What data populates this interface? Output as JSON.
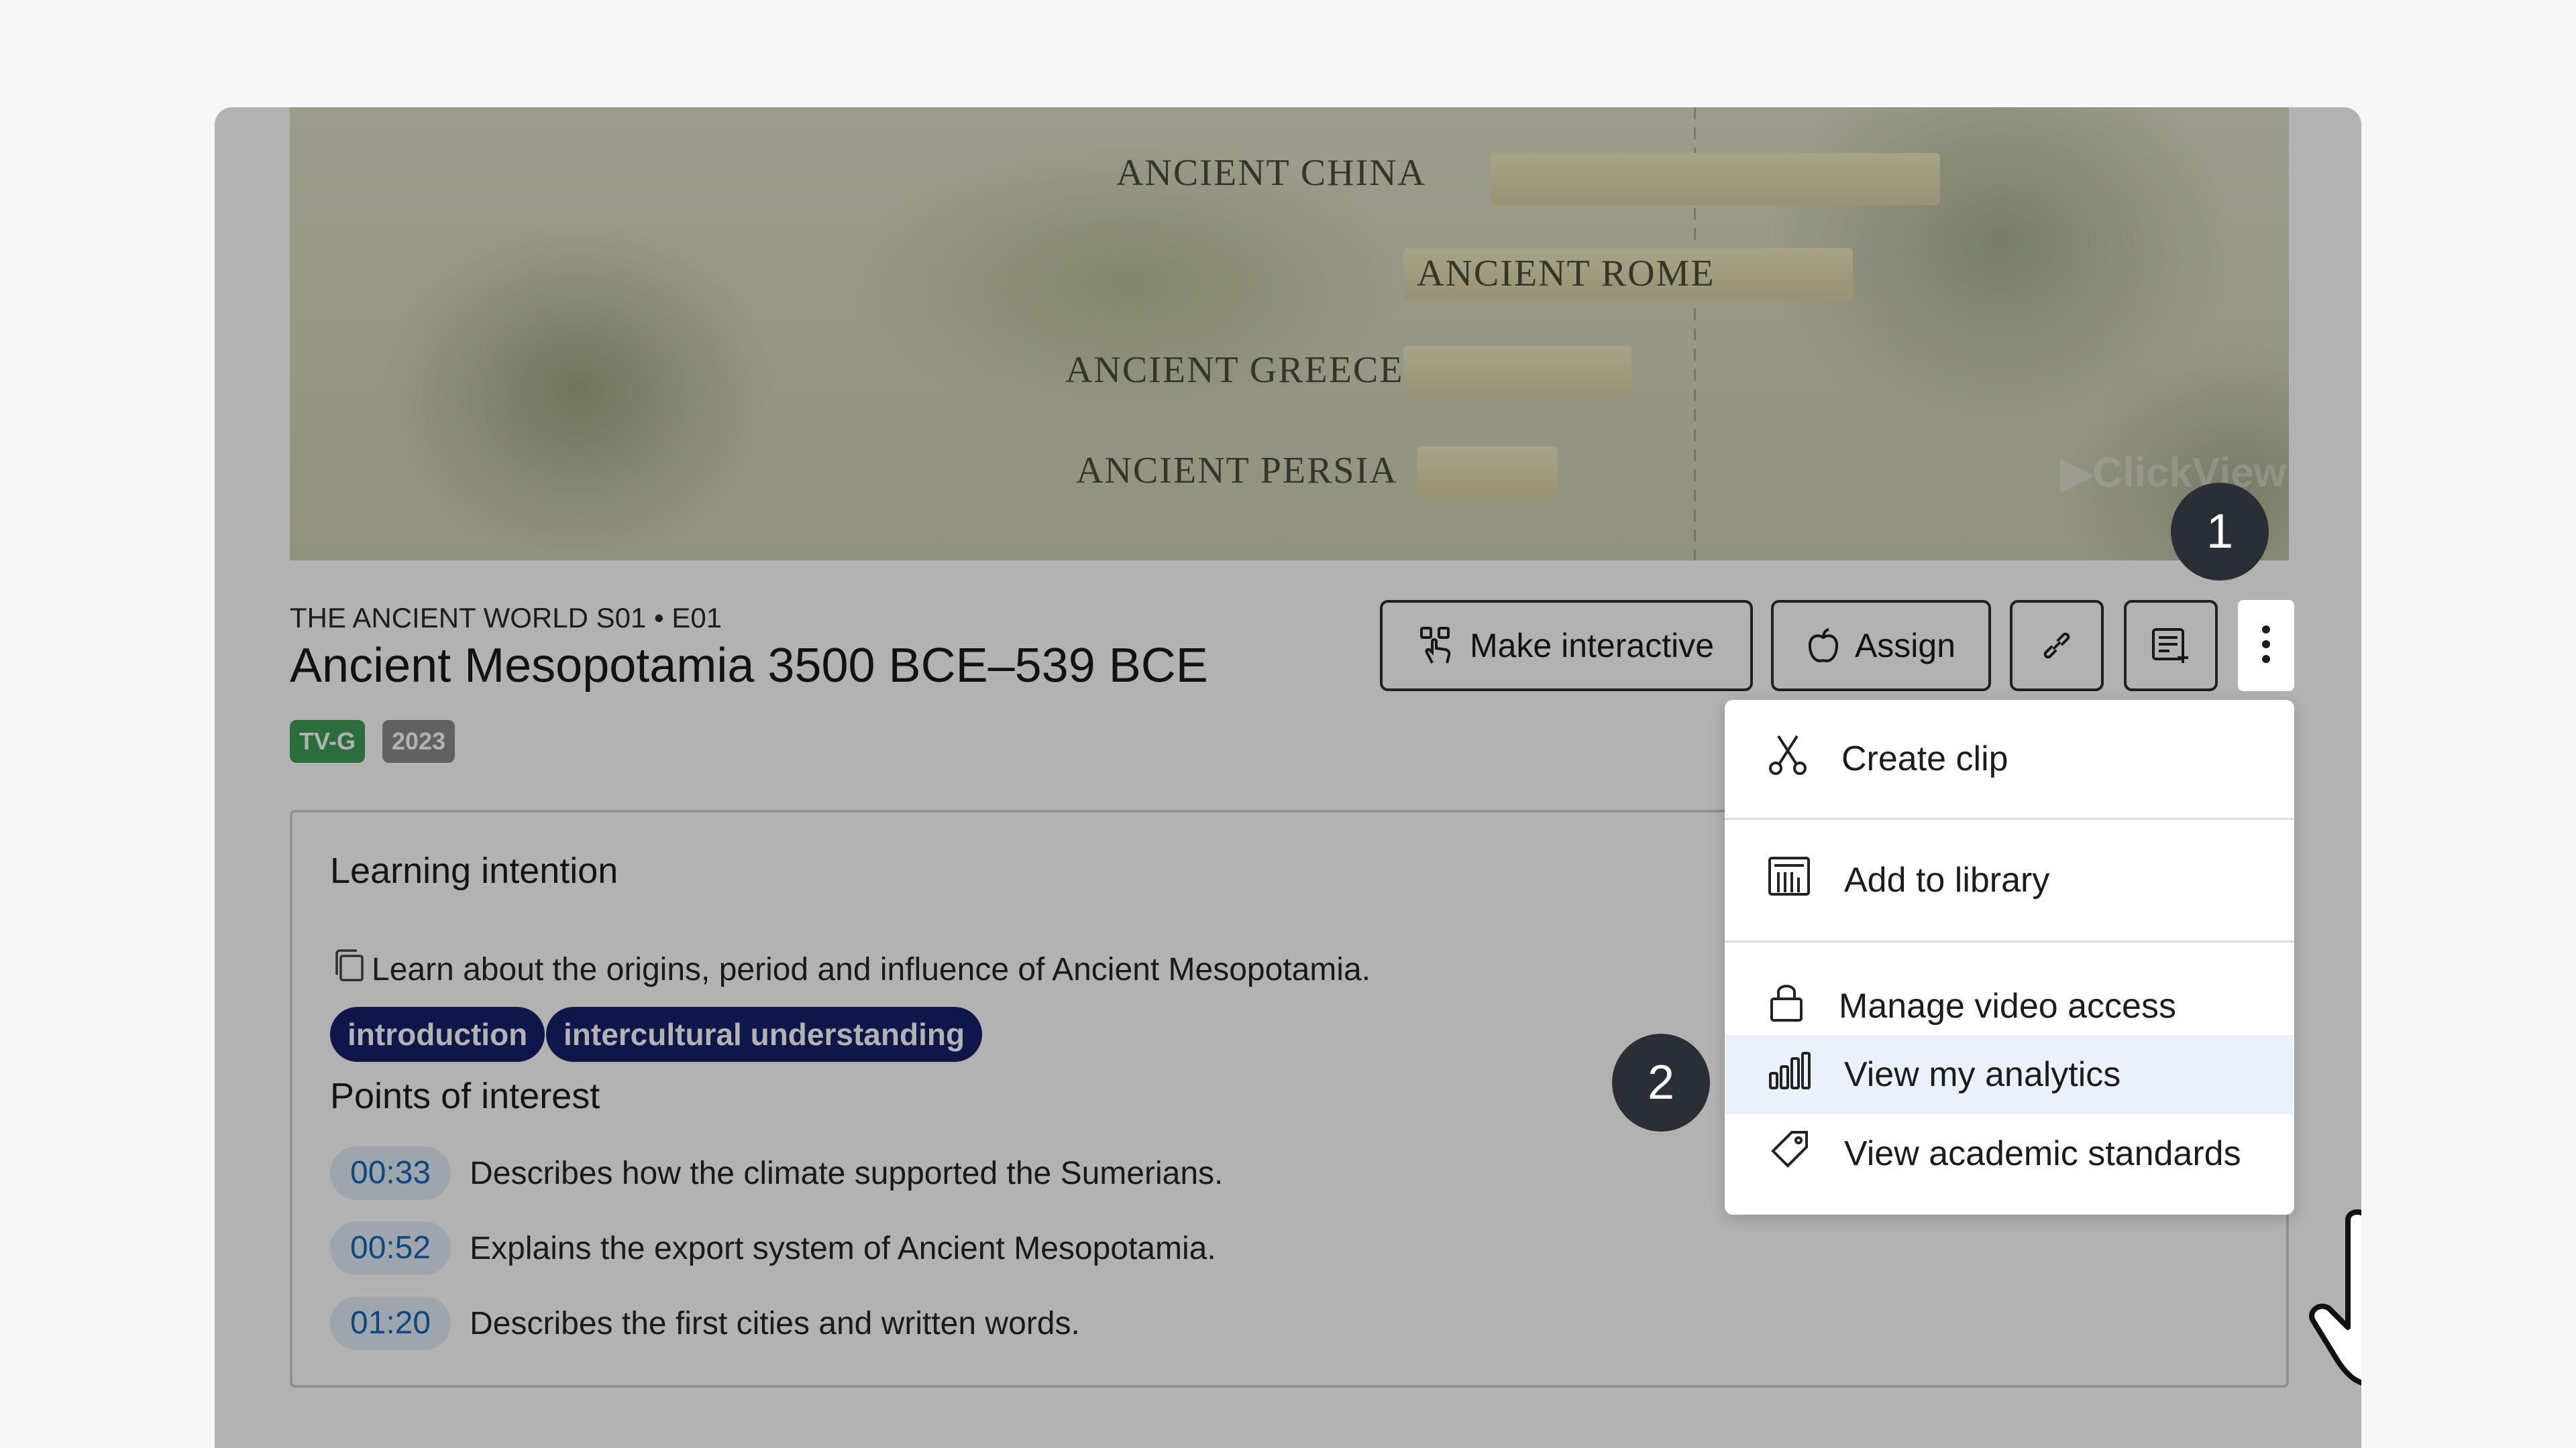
{
  "hero": {
    "labels": [
      "ANCIENT CHINA",
      "ANCIENT ROME",
      "ANCIENT GREECE",
      "ANCIENT PERSIA"
    ],
    "watermark": "▶ClickView"
  },
  "video": {
    "series": "THE ANCIENT WORLD S01 • E01",
    "title": "Ancient Mesopotamia 3500 BCE–539 BCE",
    "badges": [
      {
        "label": "TV-G",
        "color": "#3f9c57"
      },
      {
        "label": "2023",
        "color": "#8b8b8b"
      }
    ]
  },
  "toolbar": {
    "make_interactive_label": "Make interactive",
    "assign_label": "Assign"
  },
  "learning": {
    "heading": "Learning intention",
    "text": "Learn about the origins, period and influence of Ancient Mesopotamia.",
    "tags": [
      "introduction",
      "intercultural understanding"
    ]
  },
  "points": {
    "heading": "Points of interest",
    "items": [
      {
        "time": "00:33",
        "text": "Describes how the climate supported the Sumerians."
      },
      {
        "time": "00:52",
        "text": "Explains the export system of Ancient Mesopotamia."
      },
      {
        "time": "01:20",
        "text": "Describes the first cities and written words."
      }
    ]
  },
  "menu": {
    "items": [
      {
        "label": "Create clip",
        "icon": "scissors-icon"
      },
      {
        "label": "Add to library",
        "icon": "library-icon"
      },
      {
        "label": "Manage video access",
        "icon": "lock-icon"
      },
      {
        "label": "View my analytics",
        "icon": "bar-chart-icon"
      },
      {
        "label": "View academic standards",
        "icon": "tag-icon"
      }
    ]
  },
  "steps": [
    "1",
    "2"
  ],
  "colors": {
    "tag_bg": "#16226a",
    "time_chip_bg": "#e3eef8",
    "time_chip_text": "#1766b8",
    "step_bg": "#2a2f36",
    "menu_active_bg": "#e9f1fa"
  }
}
